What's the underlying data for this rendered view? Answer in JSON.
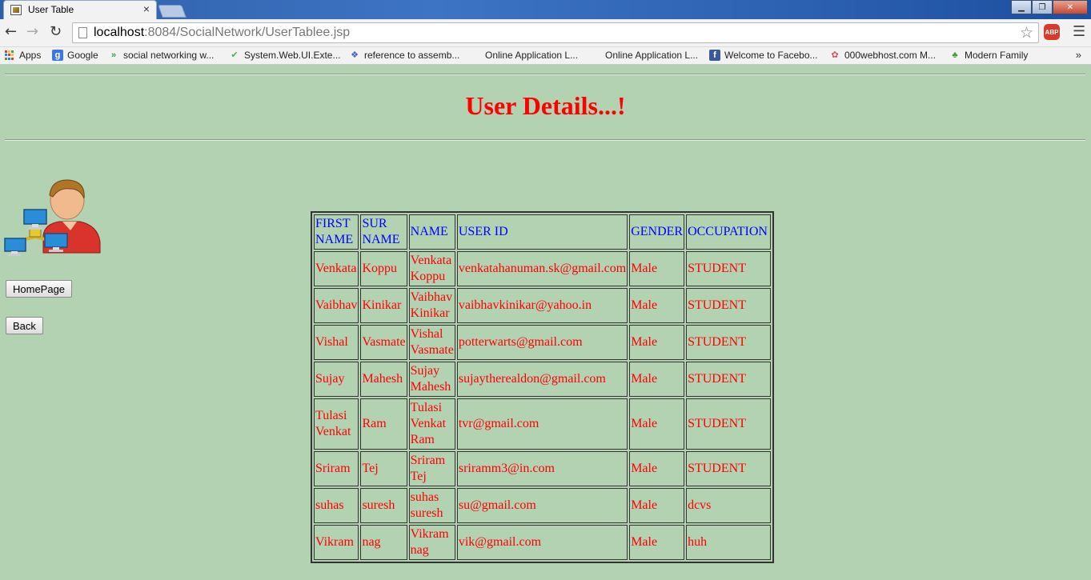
{
  "window": {
    "tab_title": "User Table",
    "close_glyph": "×",
    "controls": [
      "▁",
      "❐",
      "✕"
    ]
  },
  "toolbar": {
    "url_host": "localhost",
    "url_rest": ":8084/SocialNetwork/UserTablee.jsp",
    "abp_label": "ABP"
  },
  "bookmarks": [
    {
      "label": "Apps",
      "icon": "apps-grid-icon"
    },
    {
      "label": "Google",
      "icon": "google-icon"
    },
    {
      "label": "social networking w...",
      "icon": "double-chevron-icon"
    },
    {
      "label": "System.Web.UI.Exte...",
      "icon": "checkmark-icon"
    },
    {
      "label": "reference to assemb...",
      "icon": "dropbox-icon"
    },
    {
      "label": "Online Application L...",
      "icon": "blank-page-icon"
    },
    {
      "label": "Online Application L...",
      "icon": "blank-page-icon"
    },
    {
      "label": "Welcome to Facebo...",
      "icon": "facebook-icon"
    },
    {
      "label": "000webhost.com M...",
      "icon": "swirl-icon"
    },
    {
      "label": "Modern Family",
      "icon": "tree-icon"
    }
  ],
  "page": {
    "title": "User Details...!",
    "homepage_button": "HomePage",
    "back_button": "Back"
  },
  "table": {
    "headers": [
      "FIRST NAME",
      "SUR NAME",
      "NAME",
      "USER ID",
      "GENDER",
      "OCCUPATION"
    ],
    "rows": [
      [
        "Venkata",
        "Koppu",
        "Venkata Koppu",
        "venkatahanuman.sk@gmail.com",
        "Male",
        "STUDENT"
      ],
      [
        "Vaibhav",
        "Kinikar",
        "Vaibhav Kinikar",
        "vaibhavkinikar@yahoo.in",
        "Male",
        "STUDENT"
      ],
      [
        "Vishal",
        "Vasmate",
        "Vishal Vasmate",
        "potterwarts@gmail.com",
        "Male",
        "STUDENT"
      ],
      [
        "Sujay",
        "Mahesh",
        "Sujay Mahesh",
        "sujaytherealdon@gmail.com",
        "Male",
        "STUDENT"
      ],
      [
        "Tulasi Venkat",
        "Ram",
        "Tulasi Venkat Ram",
        "tvr@gmail.com",
        "Male",
        "STUDENT"
      ],
      [
        "Sriram",
        "Tej",
        "Sriram Tej",
        "sriramm3@in.com",
        "Male",
        "STUDENT"
      ],
      [
        "suhas",
        "suresh",
        "suhas suresh",
        "su@gmail.com",
        "Male",
        "dcvs"
      ],
      [
        "Vikram",
        "nag",
        "Vikram nag",
        "vik@gmail.com",
        "Male",
        "huh"
      ]
    ]
  },
  "colors": {
    "page_background": "#b2d2b2",
    "title": "#ff0000",
    "header_text": "#0000ff",
    "cell_text": "#ff0000"
  }
}
